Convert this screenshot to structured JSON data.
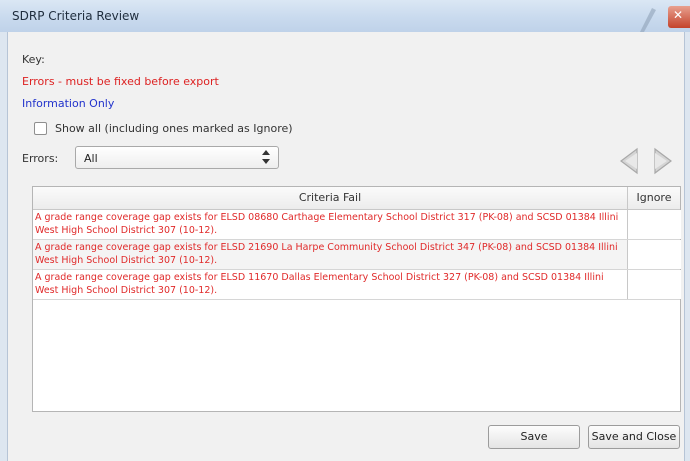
{
  "window": {
    "title": "SDRP Criteria Review",
    "close_glyph": "✕"
  },
  "key": {
    "label": "Key:",
    "errors": "Errors - must be fixed before export",
    "info": "Information Only"
  },
  "show_all": {
    "label": "Show all (including ones marked as Ignore)",
    "checked": false
  },
  "filter": {
    "label": "Errors:",
    "selected": "All",
    "arrow": "⬍"
  },
  "grid": {
    "columns": [
      "Criteria Fail",
      "Ignore"
    ],
    "rows": [
      {
        "text": "A grade range coverage gap exists for ELSD 08680 Carthage Elementary School District 317 (PK-08) and SCSD 01384 Illini West High School District 307 (10-12).",
        "ignore": ""
      },
      {
        "text": "A grade range coverage gap exists for ELSD 21690 La Harpe Community School District 347 (PK-08) and SCSD 01384 Illini West High School District 307 (10-12).",
        "ignore": ""
      },
      {
        "text": "A grade range coverage gap exists for ELSD 11670 Dallas Elementary School District 327 (PK-08) and SCSD 01384 Illini West High School District 307 (10-12).",
        "ignore": ""
      }
    ]
  },
  "buttons": {
    "save": "Save",
    "save_close": "Save and Close"
  },
  "colors": {
    "error_text": "#dd2222",
    "info_text": "#2233cc"
  },
  "icons": {
    "prev": "triangle-left-icon",
    "next": "triangle-right-icon"
  }
}
